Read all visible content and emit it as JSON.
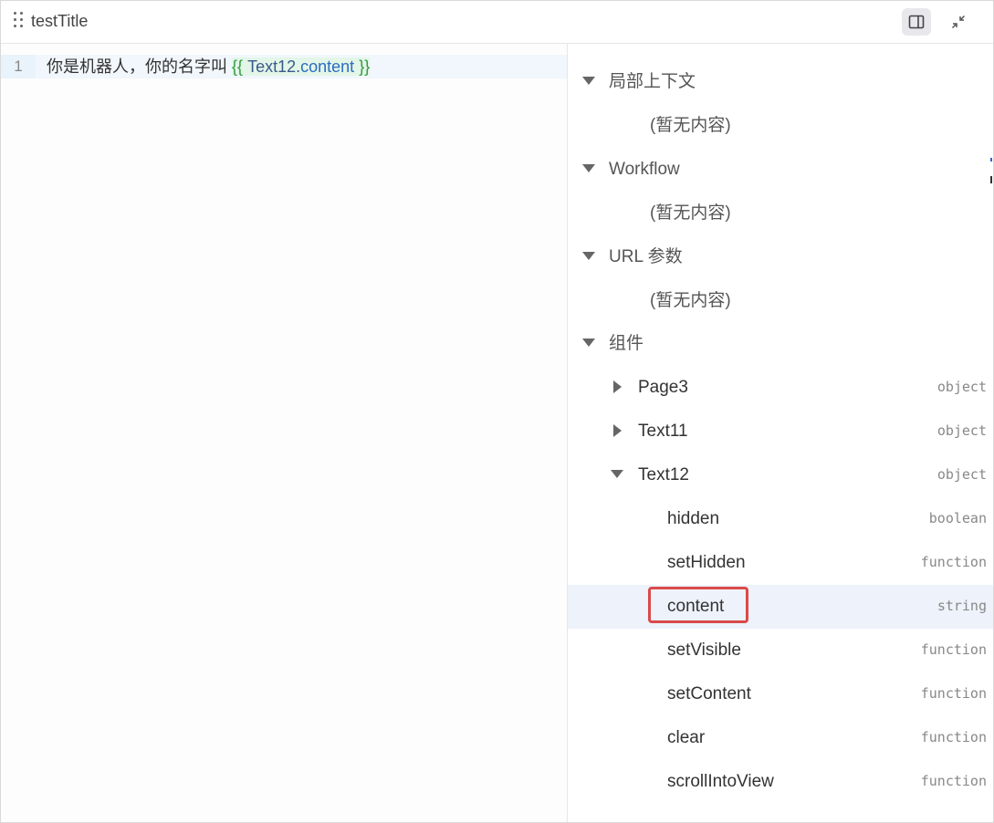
{
  "header": {
    "title": "testTitle",
    "drag_icon": "drag-dots-icon",
    "panel_icon": "side-panel-icon",
    "collapse_icon": "collapse-arrows-icon"
  },
  "editor": {
    "line_number": "1",
    "text_prefix": "你是机器人，你的名字叫",
    "tpl_open": "{{",
    "tpl_object": "Text12",
    "tpl_dot": ".",
    "tpl_prop": "content",
    "tpl_close": "}}"
  },
  "panel": {
    "sections": [
      {
        "label": "局部上下文",
        "empty": "(暂无内容)"
      },
      {
        "label": "Workflow",
        "empty": "(暂无内容)"
      },
      {
        "label": "URL 参数",
        "empty": "(暂无内容)"
      },
      {
        "label": "组件"
      }
    ],
    "components": [
      {
        "label": "Page3",
        "type": "object"
      },
      {
        "label": "Text11",
        "type": "object"
      },
      {
        "label": "Text12",
        "type": "object"
      }
    ],
    "properties": [
      {
        "label": "hidden",
        "type": "boolean"
      },
      {
        "label": "setHidden",
        "type": "function"
      },
      {
        "label": "content",
        "type": "string"
      },
      {
        "label": "setVisible",
        "type": "function"
      },
      {
        "label": "setContent",
        "type": "function"
      },
      {
        "label": "clear",
        "type": "function"
      },
      {
        "label": "scrollIntoView",
        "type": "function"
      }
    ]
  },
  "colors": {
    "highlight_row": "#eef2fb",
    "annotation_box": "#d94a4a",
    "template_green": "#2f9a3f"
  }
}
